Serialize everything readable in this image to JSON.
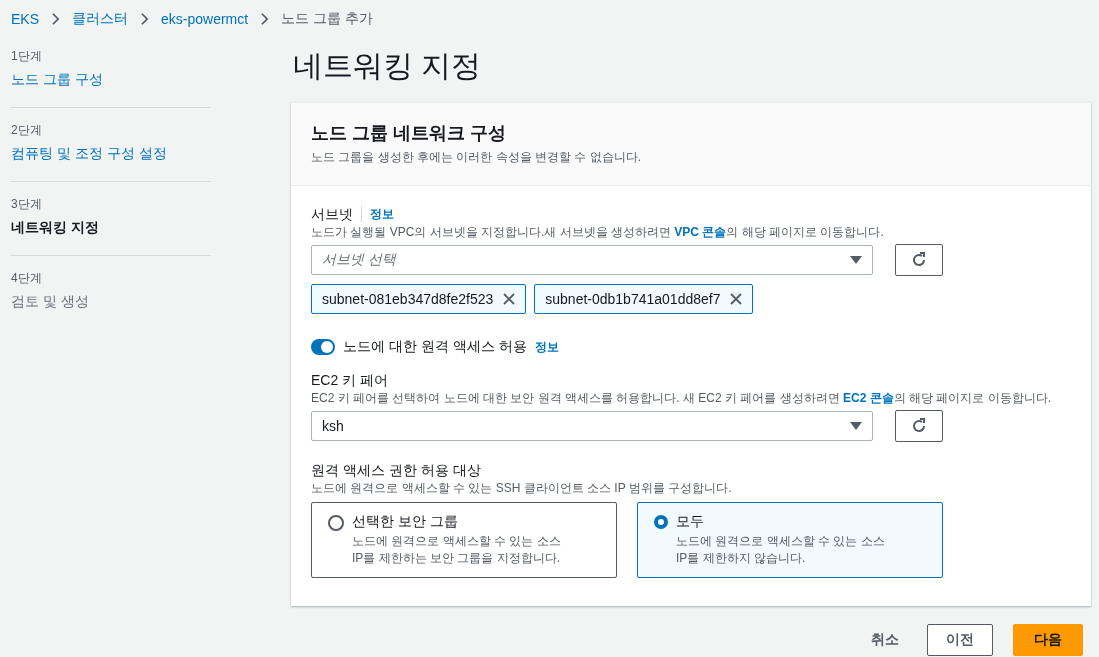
{
  "breadcrumb": [
    {
      "label": "EKS",
      "link": true
    },
    {
      "label": "클러스터",
      "link": true
    },
    {
      "label": "eks-powermct",
      "link": true
    },
    {
      "label": "노드 그룹 추가",
      "link": false
    }
  ],
  "steps": [
    {
      "step": "1단계",
      "label": "노드 그룹 구성",
      "selected": false,
      "disabled": false
    },
    {
      "step": "2단계",
      "label": "컴퓨팅 및 조정 구성 설정",
      "selected": false,
      "disabled": false
    },
    {
      "step": "3단계",
      "label": "네트워킹 지정",
      "selected": true,
      "disabled": false
    },
    {
      "step": "4단계",
      "label": "검토 및 생성",
      "selected": false,
      "disabled": true
    }
  ],
  "page_title": "네트워킹 지정",
  "panel": {
    "title": "노드 그룹 네트워크 구성",
    "description": "노드 그룹을 생성한 후에는 이러한 속성을 변경할 수 없습니다.",
    "subnet": {
      "label": "서브넷",
      "info": "정보",
      "description": {
        "before": "노드가 실행될 VPC의 서브넷을 지정합니다.새 서브넷을 생성하려면 ",
        "link": "VPC 콘솔",
        "after": "의 해당 페이지로 이동합니다."
      },
      "placeholder": "서브넷 선택",
      "tokens": [
        "subnet-081eb347d8fe2f523",
        "subnet-0db1b741a01dd8ef7"
      ]
    },
    "remote_access": {
      "label": "노드에 대한 원격 액세스 허용",
      "info": "정보",
      "on": true
    },
    "key_pair": {
      "label": "EC2 키 페어",
      "description": {
        "before": "EC2 키 페어를 선택하여 노드에 대한 보안 원격 액세스를 허용합니다. 새 EC2 키 페어를 생성하려면 ",
        "link": "EC2 콘솔",
        "after": "의 해당 페이지로 이동합니다."
      },
      "value": "ksh"
    },
    "access_target": {
      "label": "원격 액세스 권한 허용 대상",
      "description": "노드에 원격으로 액세스할 수 있는 SSH 클라이언트 소스 IP 범위를 구성합니다.",
      "options": [
        {
          "label": "선택한 보안 그룹",
          "description": "노드에 원격으로 액세스할 수 있는 소스 IP를 제한하는 보안 그룹을 지정합니다.",
          "selected": false
        },
        {
          "label": "모두",
          "description": "노드에 원격으로 액세스할 수 있는 소스 IP를 제한하지 않습니다.",
          "selected": true
        }
      ]
    }
  },
  "footer": {
    "cancel": "취소",
    "previous": "이전",
    "next": "다음"
  }
}
